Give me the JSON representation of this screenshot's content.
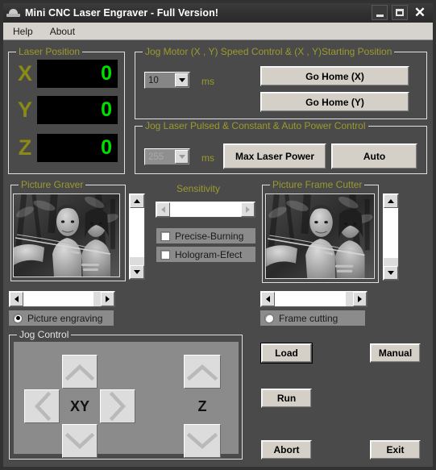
{
  "window": {
    "title": "Mini CNC Laser Engraver - Full Version!",
    "icon": "cnc-machine-icon",
    "controls": {
      "minimize": "minimize-icon",
      "maximize": "maximize-icon",
      "close": "close-icon"
    }
  },
  "menubar": {
    "items": [
      {
        "label": "Help"
      },
      {
        "label": "About"
      }
    ]
  },
  "laser_position": {
    "legend": "Laser Position",
    "axes": [
      {
        "label": "X",
        "value": "0"
      },
      {
        "label": "Y",
        "value": "0"
      },
      {
        "label": "Z",
        "value": "0"
      }
    ]
  },
  "jog_motor": {
    "legend": "Jog Motor (X , Y) Speed Control & (X , Y)Starting Position",
    "speed_combo": {
      "value": "10",
      "enabled": true
    },
    "unit": "ms",
    "buttons": [
      {
        "label": "Go Home (X)"
      },
      {
        "label": "Go Home (Y)"
      }
    ]
  },
  "jog_laser": {
    "legend": "Jog Laser Pulsed & Constant & Auto Power Control",
    "power_combo": {
      "value": "255",
      "enabled": false
    },
    "unit": "ms",
    "buttons": [
      {
        "label": "Max Laser Power"
      },
      {
        "label": "Auto"
      }
    ]
  },
  "picture_graver": {
    "legend": "Picture Graver",
    "image_alt": "grayscale-photo-two-people-jungle",
    "vscrollbar": "vertical-scrollbar",
    "hscrollbar": "horizontal-scrollbar",
    "radio": {
      "label": "Picture engraving",
      "checked": true
    }
  },
  "sensitivity": {
    "title": "Sensitivity",
    "slider": "sensitivity-scrollbar",
    "checkboxes": [
      {
        "label": "Precise-Burning",
        "checked": false
      },
      {
        "label": "Hologram-Efect",
        "checked": false
      }
    ]
  },
  "picture_frame_cutter": {
    "legend": "Picture Frame Cutter",
    "image_alt": "grayscale-photo-two-people-jungle",
    "vscrollbar": "vertical-scrollbar",
    "hscrollbar": "horizontal-scrollbar",
    "radio": {
      "label": "Frame cutting",
      "checked": false
    }
  },
  "jog_control": {
    "legend": "Jog Control",
    "xy_label": "XY",
    "z_label": "Z",
    "buttons": {
      "xy_up": "arrow-up-icon",
      "xy_down": "arrow-down-icon",
      "xy_left": "arrow-left-icon",
      "xy_right": "arrow-right-icon",
      "z_up": "arrow-up-icon",
      "z_down": "arrow-down-icon"
    }
  },
  "actions": {
    "load": {
      "label": "Load",
      "focused": true
    },
    "run": {
      "label": "Run",
      "focused": false
    },
    "abort": {
      "label": "Abort",
      "focused": false
    },
    "manual": {
      "label": "Manual",
      "focused": false
    },
    "exit": {
      "label": "Exit",
      "focused": false
    }
  },
  "colors": {
    "window_bg": "#4a4a4a",
    "legend_olive": "#9a9a2e",
    "axis_label": "#8a8a16",
    "readout_green": "#00e000",
    "button_face": "#d4d0c8",
    "control_gray": "#8b8b8b"
  }
}
